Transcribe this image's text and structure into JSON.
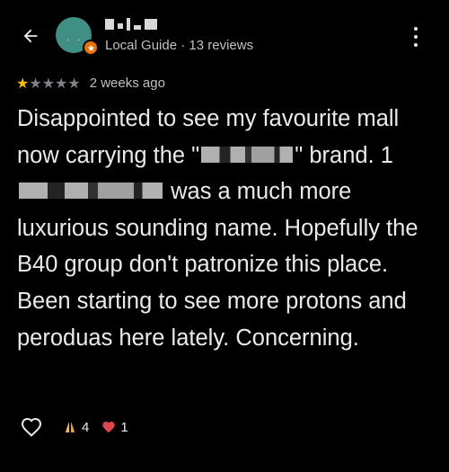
{
  "header": {
    "back_icon": "arrow-left-icon",
    "avatar_initial": ". .",
    "author_meta": "Local Guide · 13 reviews",
    "badge_icon": "local-guide-star-icon",
    "more_icon": "more-vert-icon"
  },
  "review": {
    "rating": 1,
    "max_rating": 5,
    "time_ago": "2 weeks ago",
    "text_parts": {
      "p1": "Disappointed to see my favourite mall now carrying the \"",
      "p2": "\" brand. 1",
      "p3": "was a much more luxurious sounding name. Hopefully the B40 group don't patronize this place. Been starting to see more protons and peroduas here lately. Concerning."
    }
  },
  "actions": {
    "like_icon": "heart-outline-icon",
    "reactions": [
      {
        "emoji": "🙏",
        "icon": "folded-hands-icon",
        "count": "4"
      },
      {
        "emoji": "❤",
        "icon": "red-heart-icon",
        "count": "1"
      }
    ]
  },
  "colors": {
    "background": "#000000",
    "text_primary": "#e8eaed",
    "text_secondary": "#bdc1c6",
    "star_filled": "#fbbc04",
    "star_empty": "#7e8185",
    "avatar_bg": "#3f8f84",
    "badge_bg": "#e8710a"
  }
}
